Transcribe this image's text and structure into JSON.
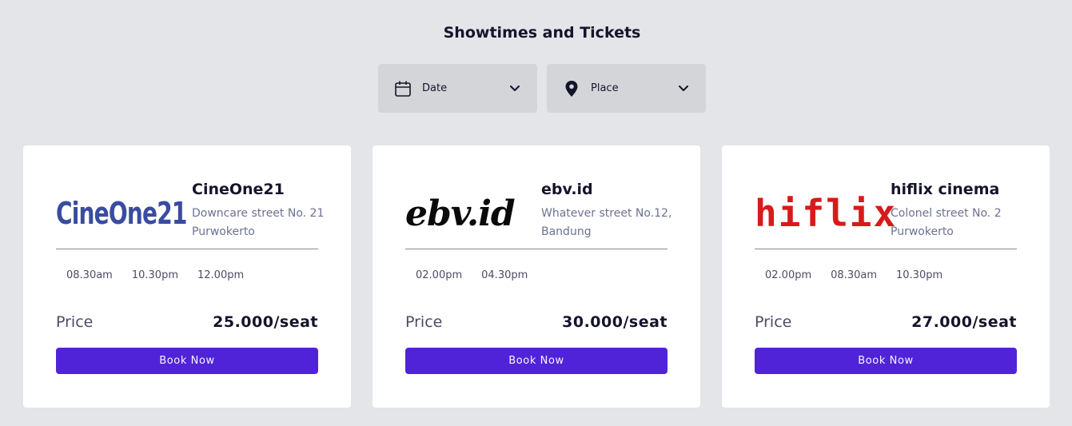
{
  "header": {
    "title": "Showtimes and Tickets"
  },
  "filters": {
    "date": {
      "label": "Date",
      "icon": "calendar-icon"
    },
    "place": {
      "label": "Place",
      "icon": "map-pin-icon"
    }
  },
  "cinemas": [
    {
      "logo_text": "CineOne21",
      "name": "CineOne21",
      "address": "Downcare street No. 21 Purwokerto",
      "times": [
        "08.30am",
        "10.30pm",
        "12.00pm"
      ],
      "price_label": "Price",
      "price": "25.000/seat",
      "book_label": "Book Now"
    },
    {
      "logo_text": "ebv.id",
      "name": "ebv.id",
      "address": "Whatever street No.12, Bandung",
      "times": [
        "02.00pm",
        "04.30pm"
      ],
      "price_label": "Price",
      "price": "30.000/seat",
      "book_label": "Book Now"
    },
    {
      "logo_text": "hiflix",
      "name": "hiflix cinema",
      "address": "Colonel street No. 2 Purwokerto",
      "times": [
        "02.00pm",
        "08.30am",
        "10.30pm"
      ],
      "price_label": "Price",
      "price": "27.000/seat",
      "book_label": "Book Now"
    }
  ],
  "colors": {
    "background": "#e4e5e9",
    "filter_bg": "#d4d5d8",
    "card_bg": "#ffffff",
    "primary": "#5123d8",
    "cineone_logo": "#3a4ba0",
    "hiflix_logo": "#d71a1a"
  }
}
